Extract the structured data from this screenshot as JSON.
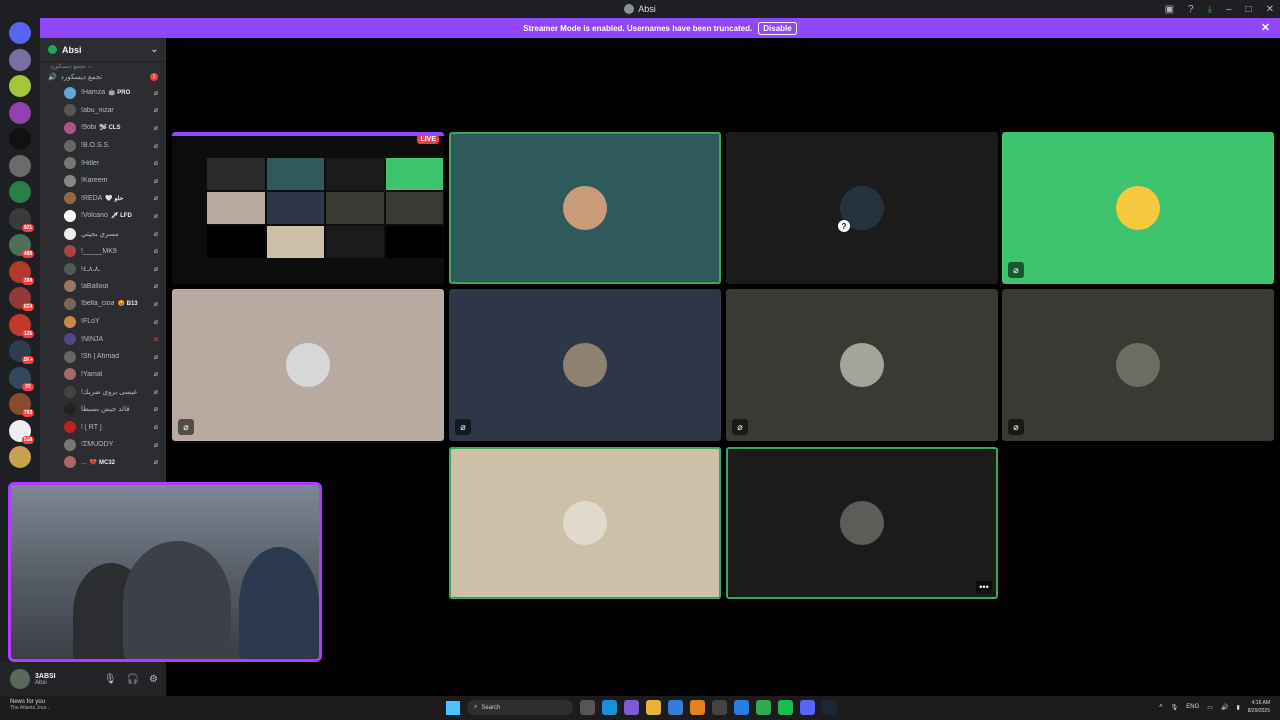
{
  "window": {
    "title": "Absi"
  },
  "banner": {
    "message": "Streamer Mode is enabled. Usernames have been truncated.",
    "button": "Disable"
  },
  "servers": [
    {
      "badge": "",
      "color": "#5865f2"
    },
    {
      "badge": "",
      "color": "#7a6f9e"
    },
    {
      "badge": "",
      "color": "#a4c639"
    },
    {
      "badge": "",
      "color": "#8e44ad"
    },
    {
      "badge": "",
      "color": "#111111"
    },
    {
      "badge": "",
      "color": "#6b6b6b"
    },
    {
      "badge": "",
      "color": "#2d7d46"
    },
    {
      "badge": "921",
      "color": "#3a3a3a"
    },
    {
      "badge": "488",
      "color": "#4e6e58"
    },
    {
      "badge": "394",
      "color": "#b03a2e"
    },
    {
      "badge": "824",
      "color": "#923a3a"
    },
    {
      "badge": "126",
      "color": "#c0392b"
    },
    {
      "badge": "1K+",
      "color": "#2c3e50"
    },
    {
      "badge": "92",
      "color": "#34495e"
    },
    {
      "badge": "783",
      "color": "#8b4a2b"
    },
    {
      "badge": "518",
      "color": "#eeeeee"
    },
    {
      "badge": "",
      "color": "#c8a050"
    }
  ],
  "channels": {
    "server_name": "Absi",
    "sub_label": "تجمع ديسكورد ⌄",
    "voice_channel": "تجمع ديسكورد",
    "voice_badge": "1",
    "members": [
      {
        "name": "!Hamza",
        "tag": "🤖 PRO",
        "color": "#5fa8d3"
      },
      {
        "name": "!abu_nizar",
        "tag": "",
        "color": "#555"
      },
      {
        "name": "!9obi",
        "tag": "🛩 CLS",
        "color": "#a58"
      },
      {
        "name": "!B.O.S.S.",
        "tag": "",
        "color": "#666"
      },
      {
        "name": "!Hitler",
        "tag": "",
        "color": "#777"
      },
      {
        "name": "!Kareem",
        "tag": "",
        "color": "#888"
      },
      {
        "name": "!REDA",
        "tag": "🤍 حلو",
        "color": "#964"
      },
      {
        "name": "!Volcano",
        "tag": "🗡 LFD",
        "color": "#fff"
      },
      {
        "name": "مسري بجيتي",
        "tag": "",
        "color": "#eee"
      },
      {
        "name": "!_____MK9",
        "tag": "",
        "color": "#a44"
      },
      {
        "name": "!ـ٨ـ٨ـ٤",
        "tag": "",
        "color": "#555"
      },
      {
        "name": "!aBallout",
        "tag": "",
        "color": "#976"
      },
      {
        "name": "!bella_cioa",
        "tag": "😡 B13",
        "color": "#765"
      },
      {
        "name": "!FLoY",
        "tag": "",
        "color": "#c84"
      },
      {
        "name": "!NINJA",
        "tag": "",
        "color": "#548"
      },
      {
        "name": "!Sh | Ahmad",
        "tag": "",
        "color": "#666"
      },
      {
        "name": "!Yamal",
        "tag": "",
        "color": "#a66"
      },
      {
        "name": "!عيسى بروي ضربك",
        "tag": "",
        "color": "#444"
      },
      {
        "name": "قائد جيش بسيطا",
        "tag": "",
        "color": "#222"
      },
      {
        "name": "! [ RT ]",
        "tag": "",
        "color": "#b22"
      },
      {
        "name": "!Σ̃MUODY",
        "tag": "",
        "color": "#777"
      },
      {
        "name": "...",
        "tag": "💔 MC32",
        "color": "#a66"
      }
    ]
  },
  "user": {
    "name": "3ABSI",
    "status": "Absi"
  },
  "stage": {
    "live_label": "LIVE",
    "more_label": "•••",
    "question_badge": "?"
  },
  "tiles": [
    {
      "bg": "#0d0d0d",
      "avatar": "#5e6b76",
      "muted": false,
      "speaking": false,
      "stream": true,
      "more": false
    },
    {
      "bg": "#2f5a5c",
      "avatar": "#c99b79",
      "muted": false,
      "speaking": true,
      "stream": false,
      "more": false
    },
    {
      "bg": "#1b1b1b",
      "avatar": "#26333f",
      "muted": false,
      "speaking": false,
      "stream": false,
      "more": false,
      "question": true
    },
    {
      "bg": "#3dc46d",
      "avatar": "#f7c940",
      "muted": true,
      "speaking": false,
      "stream": false,
      "more": false
    },
    {
      "bg": "#b8aaa0",
      "avatar": "#d6d7d9",
      "muted": true,
      "speaking": false,
      "stream": false,
      "more": false
    },
    {
      "bg": "#2e3747",
      "avatar": "#8e8172",
      "muted": true,
      "speaking": false,
      "stream": false,
      "more": false
    },
    {
      "bg": "#393a33",
      "avatar": "#a1a699",
      "muted": true,
      "speaking": false,
      "stream": false,
      "more": false
    },
    {
      "bg": "#393a33",
      "avatar": "#6d6c60",
      "muted": true,
      "speaking": false,
      "stream": false,
      "more": false
    },
    {
      "bg": "#cdbfa8",
      "avatar": "#e1d9cb",
      "muted": false,
      "speaking": true,
      "stream": false,
      "more": false
    },
    {
      "bg": "#1b1b1b",
      "avatar": "#5c5c58",
      "muted": false,
      "speaking": true,
      "stream": false,
      "more": true
    }
  ],
  "taskbar": {
    "news_title": "News for you",
    "news_sub": "The Atlanta Jour...",
    "search_placeholder": "Search",
    "lang": "ENG",
    "time": "4:16 AM",
    "date": "8/29/2025"
  }
}
